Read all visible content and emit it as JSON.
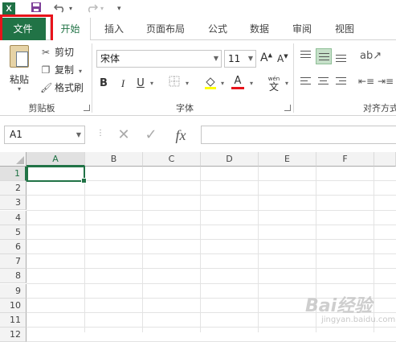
{
  "qat": {
    "app_icon": "X",
    "save_icon": "save-icon",
    "undo_icon": "undo-icon",
    "redo_icon": "redo-icon"
  },
  "tabs": [
    {
      "label": "文件"
    },
    {
      "label": "开始"
    },
    {
      "label": "插入"
    },
    {
      "label": "页面布局"
    },
    {
      "label": "公式"
    },
    {
      "label": "数据"
    },
    {
      "label": "审阅"
    },
    {
      "label": "视图"
    }
  ],
  "clipboard": {
    "paste_label": "粘贴",
    "cut_label": "剪切",
    "copy_label": "复制",
    "format_painter_label": "格式刷",
    "group_label": "剪贴板"
  },
  "font": {
    "family": "宋体",
    "size": "11",
    "grow_label": "A",
    "shrink_label": "A",
    "bold": "B",
    "italic": "I",
    "underline": "U",
    "color_label": "A",
    "wen_label": "wén",
    "wen_char": "文",
    "group_label": "字体"
  },
  "alignment": {
    "group_label": "对齐方式"
  },
  "formula_bar": {
    "name_box": "A1",
    "fx": "fx",
    "cancel_icon": "✕",
    "enter_icon": "✓"
  },
  "grid": {
    "columns": [
      "A",
      "B",
      "C",
      "D",
      "E",
      "F"
    ],
    "rows": [
      "1",
      "2",
      "3",
      "4",
      "5",
      "6",
      "7",
      "8",
      "9",
      "10",
      "11",
      "12"
    ],
    "selected_cell": "A1"
  },
  "watermark": {
    "text": "Bai经验",
    "url": "jingyan.baidu.com"
  },
  "colors": {
    "accent": "#217346",
    "highlight_box": "#e8131b"
  }
}
